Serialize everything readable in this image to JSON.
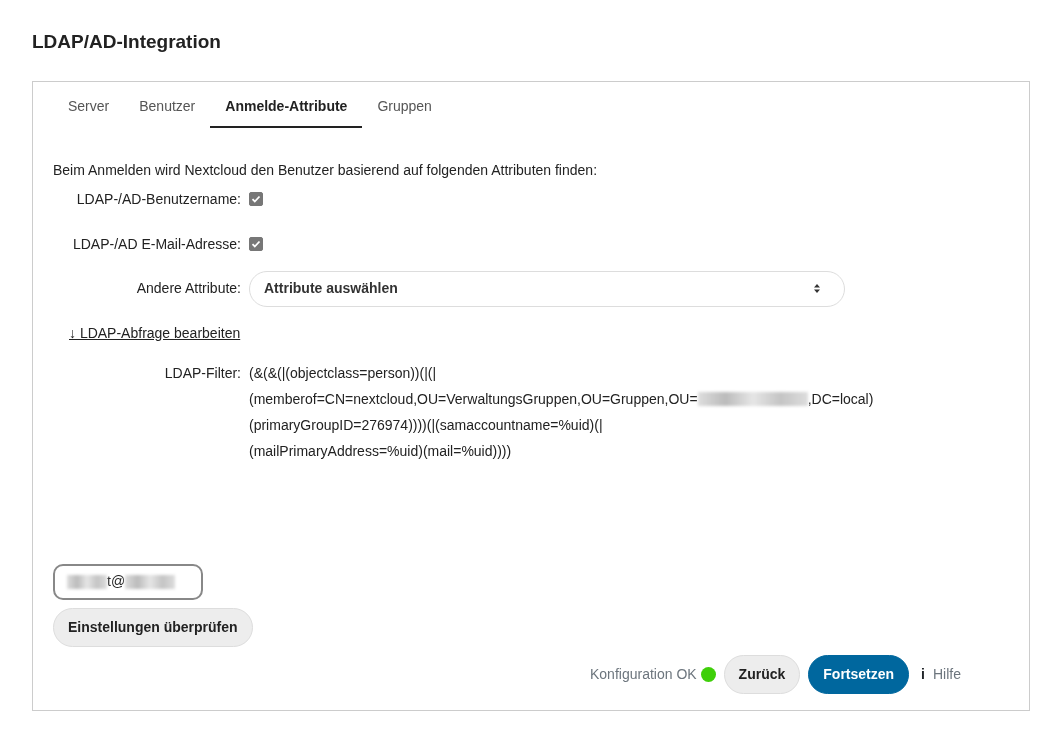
{
  "title": "LDAP/AD-Integration",
  "tabs": [
    {
      "label": "Server",
      "selected": false
    },
    {
      "label": "Benutzer",
      "selected": false
    },
    {
      "label": "Anmelde-Attribute",
      "selected": true
    },
    {
      "label": "Gruppen",
      "selected": false
    }
  ],
  "intro": "Beim Anmelden wird Nextcloud den Benutzer basierend auf folgenden Attributen finden:",
  "options": [
    {
      "label": "LDAP-/AD-Benutzername:",
      "checked": true
    },
    {
      "label": "LDAP-/AD E-Mail-Adresse:",
      "checked": true
    }
  ],
  "other_attributes": {
    "label": "Andere Attribute:",
    "value": "Attribute auswählen"
  },
  "edit_query_link": "↓ LDAP-Abfrage bearbeiten",
  "filter": {
    "label": "LDAP-Filter:",
    "lines": [
      {
        "text": "(&(&(|(objectclass=person))(|(|",
        "redacted": false
      },
      {
        "text": "(memberof=CN=nextcloud,OU=VerwaltungsGruppen,OU=Gruppen,OU=",
        "redacted": true,
        "text_after": ",DC=local)"
      },
      {
        "text": "(primaryGroupID=276974))))(|(samaccountname=%uid)(|",
        "redacted": false
      },
      {
        "text": "(mailPrimaryAddress=%uid)(mail=%uid))))",
        "redacted": false
      }
    ]
  },
  "test_login": {
    "value": "t@"
  },
  "check_button": "Einstellungen überprüfen",
  "status": {
    "text": "Konfiguration OK",
    "color": "#3fcf0a"
  },
  "buttons": [
    {
      "label": "Zurück",
      "kind": "secondary"
    },
    {
      "label": "Fortsetzen",
      "kind": "primary"
    }
  ],
  "help": {
    "icon": "i",
    "label": "Hilfe"
  }
}
